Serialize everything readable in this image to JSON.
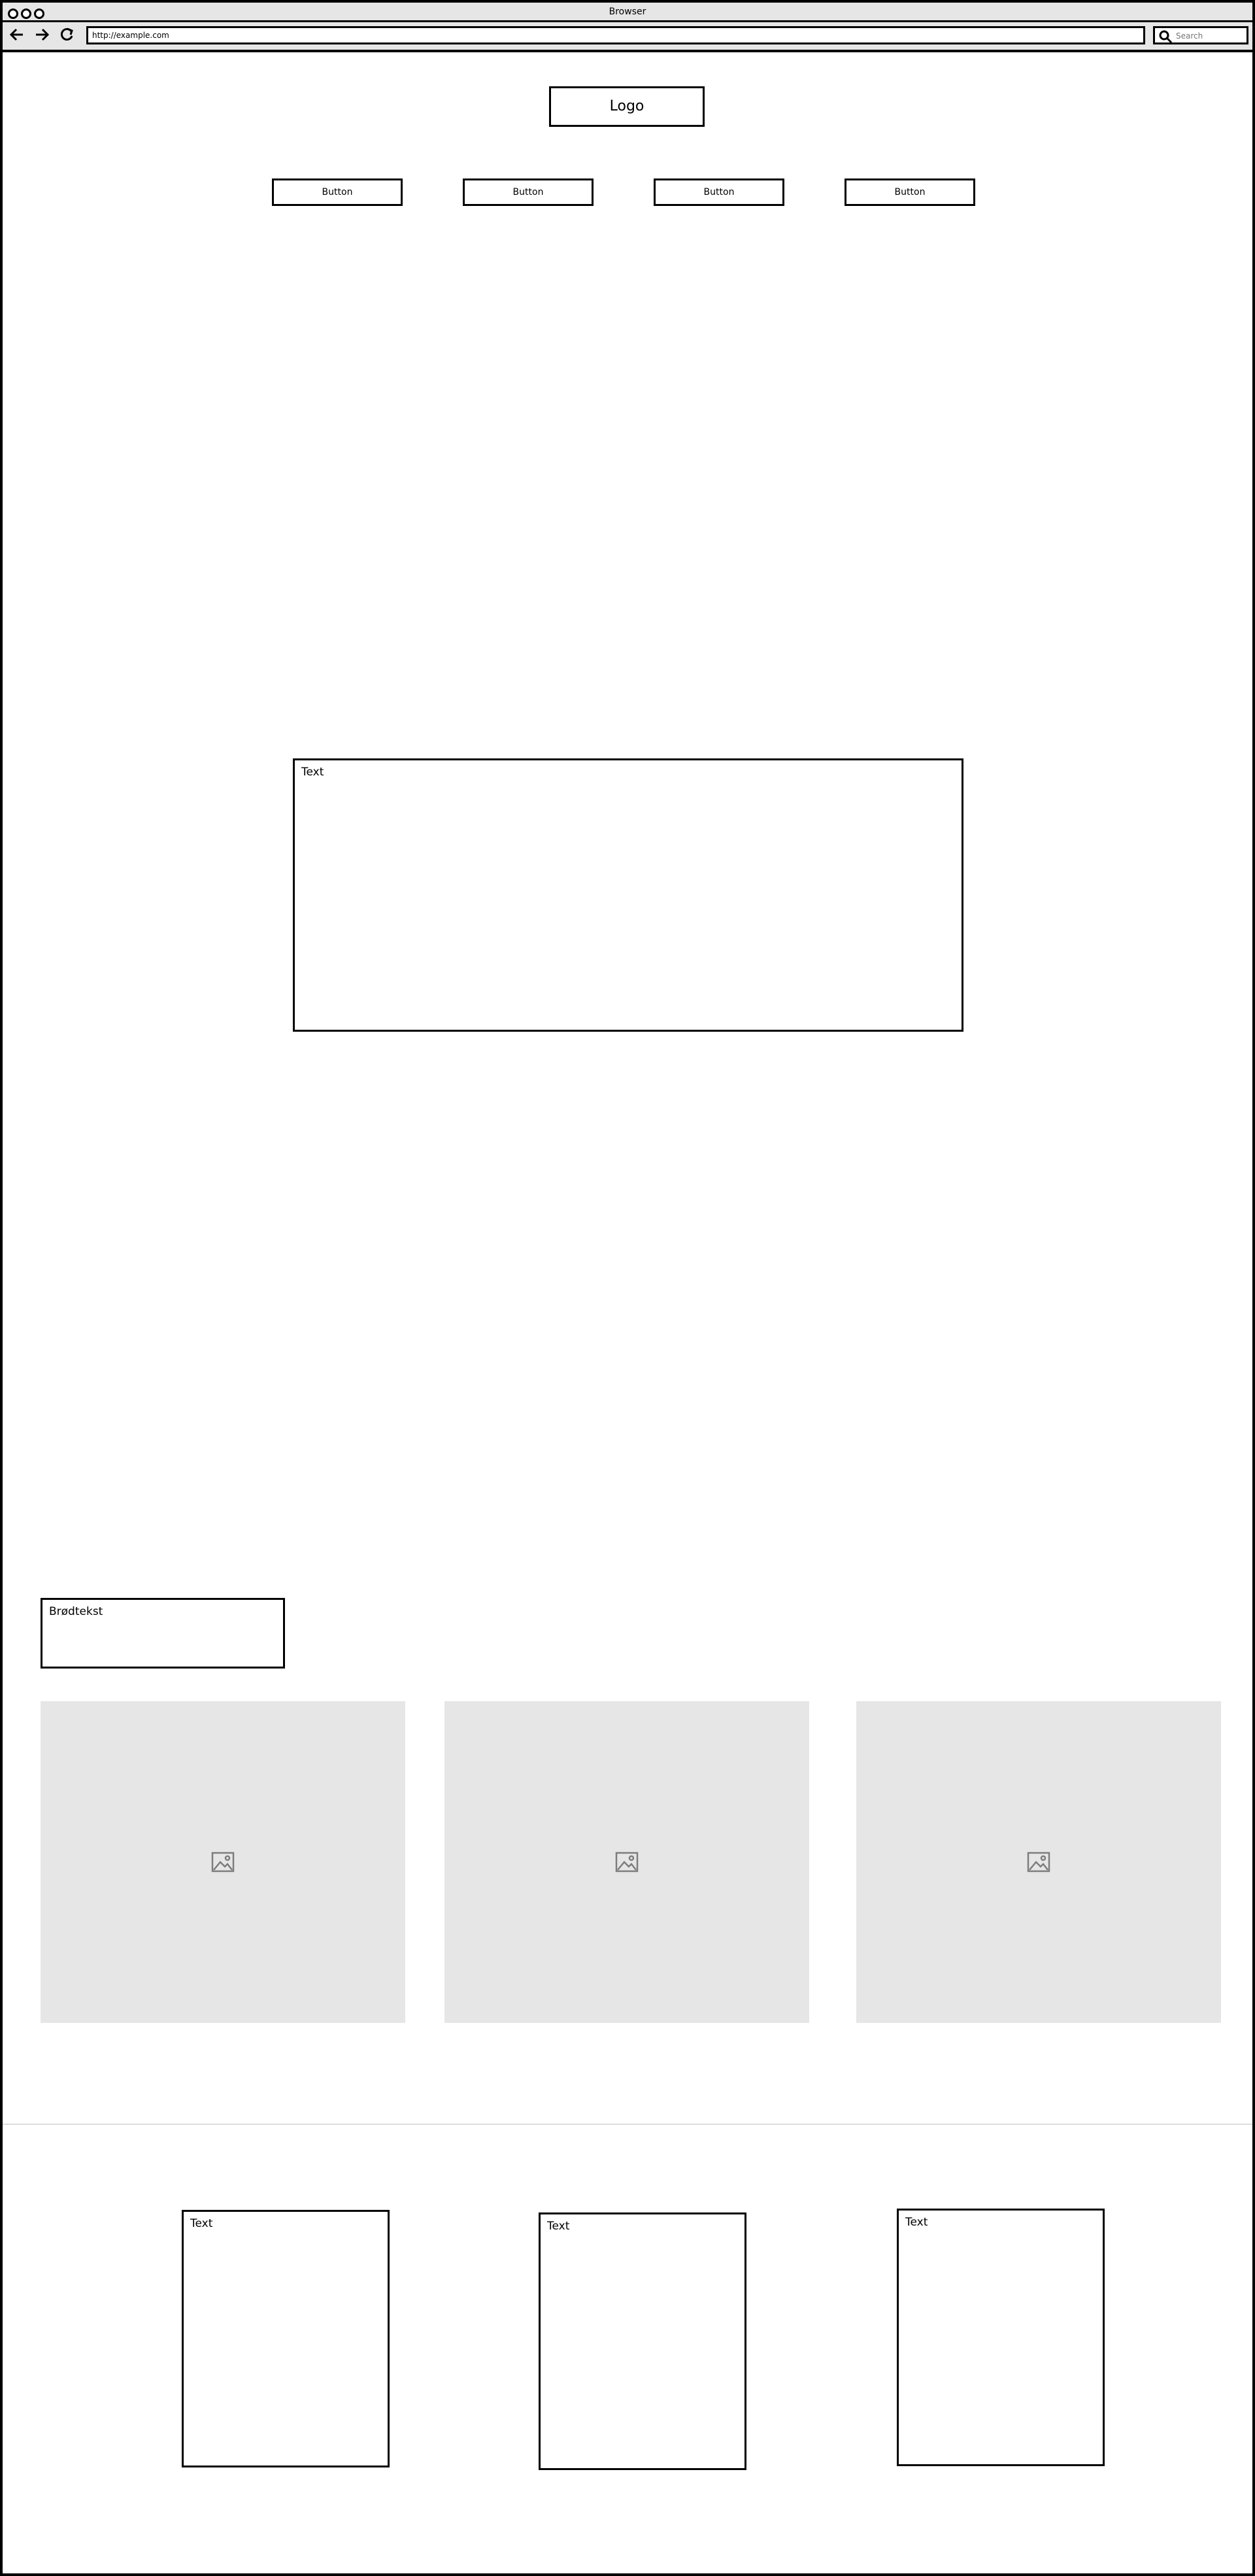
{
  "window": {
    "title": "Browser",
    "address": "http://example.com",
    "search_placeholder": "Search"
  },
  "nav": {
    "back_icon": "arrow-left-icon",
    "forward_icon": "arrow-right-icon",
    "reload_icon": "reload-icon"
  },
  "header": {
    "logo": "Logo",
    "buttons": [
      "Button",
      "Button",
      "Button",
      "Button"
    ]
  },
  "main": {
    "hero_text": "Text",
    "body_text": "Brødtekst"
  },
  "images": [
    {
      "icon": "image-icon"
    },
    {
      "icon": "image-icon"
    },
    {
      "icon": "image-icon"
    }
  ],
  "footer": {
    "texts": [
      "Text",
      "Text",
      "Text"
    ]
  },
  "colors": {
    "border": "#000000",
    "chrome": "#e6e6e6",
    "placeholder": "#e6e6e6"
  }
}
